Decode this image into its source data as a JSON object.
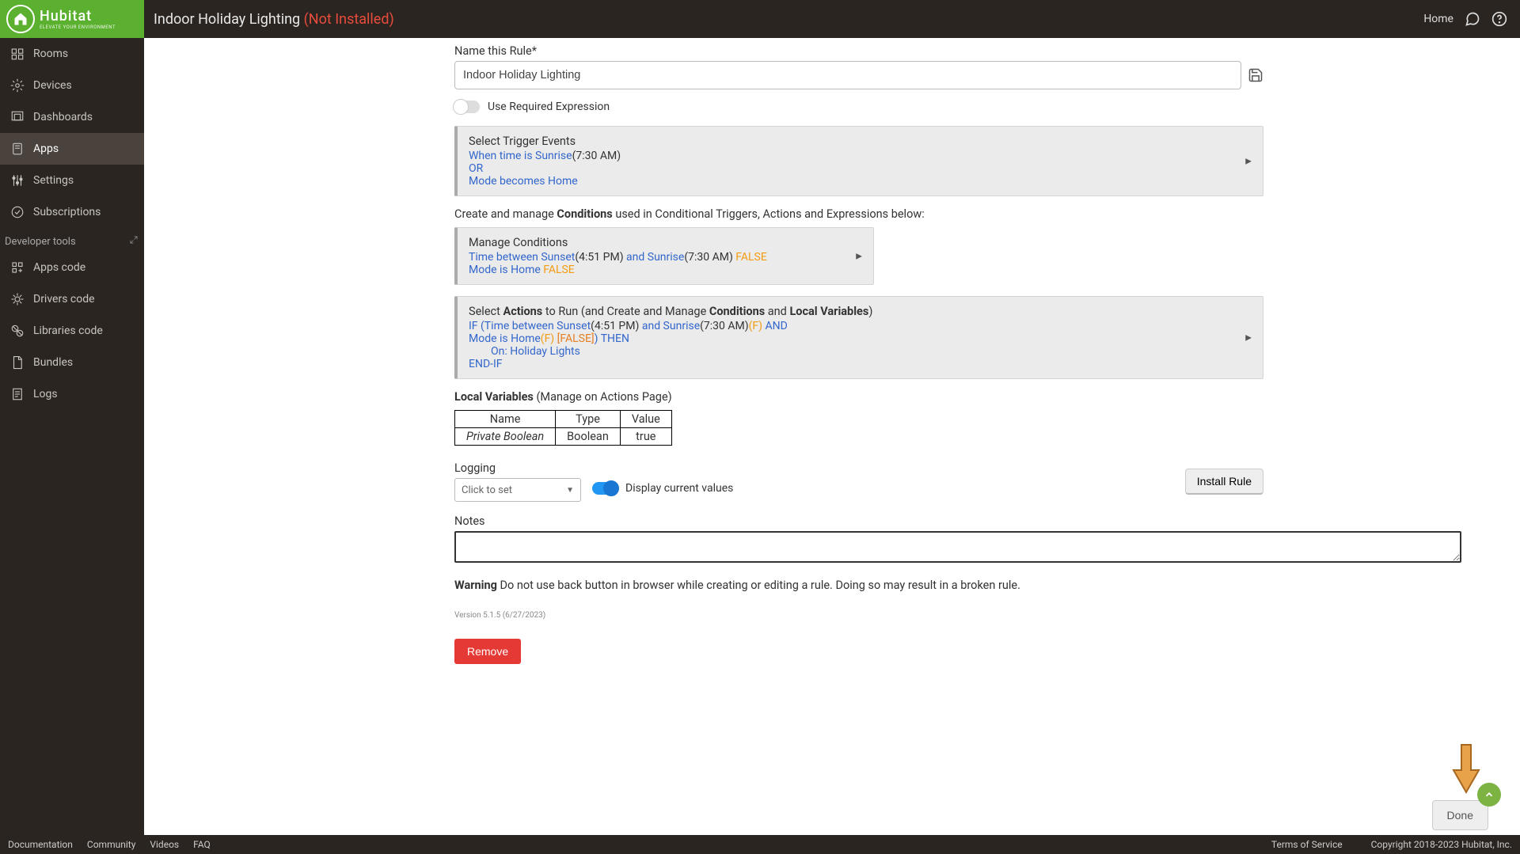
{
  "header": {
    "logo_main": "Hubitat",
    "logo_sub": "ELEVATE YOUR ENVIRONMENT",
    "page_title": "Indoor Holiday Lighting",
    "page_status": "(Not Installed)",
    "home_link": "Home"
  },
  "sidebar": {
    "items": [
      {
        "label": "Rooms"
      },
      {
        "label": "Devices"
      },
      {
        "label": "Dashboards"
      },
      {
        "label": "Apps"
      },
      {
        "label": "Settings"
      },
      {
        "label": "Subscriptions"
      }
    ],
    "dev_header": "Developer tools",
    "dev_items": [
      {
        "label": "Apps code"
      },
      {
        "label": "Drivers code"
      },
      {
        "label": "Libraries code"
      },
      {
        "label": "Bundles"
      },
      {
        "label": "Logs"
      }
    ]
  },
  "footer": {
    "links": [
      "Documentation",
      "Community",
      "Videos",
      "FAQ"
    ],
    "right": [
      "Terms of Service",
      "Copyright 2018-2023 Hubitat, Inc."
    ]
  },
  "rule": {
    "name_label": "Name this Rule*",
    "name_value": "Indoor Holiday Lighting",
    "required_expr_label": "Use Required Expression",
    "trigger": {
      "title": "Select Trigger Events",
      "line1a": "When time is Sunrise",
      "line1b": "(7:30 AM)",
      "or": "OR",
      "line2": "Mode becomes Home"
    },
    "conditions_intro_a": "Create and manage ",
    "conditions_intro_b": "Conditions",
    "conditions_intro_c": " used in Conditional Triggers, Actions and Expressions below:",
    "conditions": {
      "title": "Manage Conditions",
      "c1a": "Time between Sunset",
      "c1b": "(4:51 PM) ",
      "c1c": "and Sunrise",
      "c1d": "(7:30 AM) ",
      "c1e": "FALSE",
      "c2a": "Mode is Home ",
      "c2b": "FALSE"
    },
    "actions": {
      "title_a": "Select ",
      "title_b": "Actions",
      "title_c": " to Run (and Create and Manage ",
      "title_d": "Conditions",
      "title_e": " and ",
      "title_f": "Local Variables",
      "title_g": ")",
      "a1a": "IF (Time between Sunset",
      "a1b": "(4:51 PM) ",
      "a1c": "and Sunrise",
      "a1d": "(7:30 AM)",
      "a1e": "(F)",
      "a1f": "  AND",
      "a2a": "Mode is Home",
      "a2b": "(F) ",
      "a2c": "[FALSE]",
      "a2d": ") THEN",
      "a3": "On: Holiday Lights",
      "a4": "END-IF"
    },
    "local_vars": {
      "title_a": "Local Variables",
      "title_b": " (Manage on Actions Page)",
      "headers": [
        "Name",
        "Type",
        "Value"
      ],
      "row": [
        "Private Boolean",
        "Boolean",
        "true"
      ]
    },
    "logging_label": "Logging",
    "logging_select": "Click to set",
    "display_values_label": "Display current values",
    "install_btn": "Install Rule",
    "notes_label": "Notes",
    "warning_a": "Warning",
    "warning_b": " Do not use back button in browser while creating or editing a rule. Doing so may result in a broken rule.",
    "version": "Version 5.1.5 (6/27/2023)",
    "remove_btn": "Remove",
    "done_btn": "Done"
  }
}
